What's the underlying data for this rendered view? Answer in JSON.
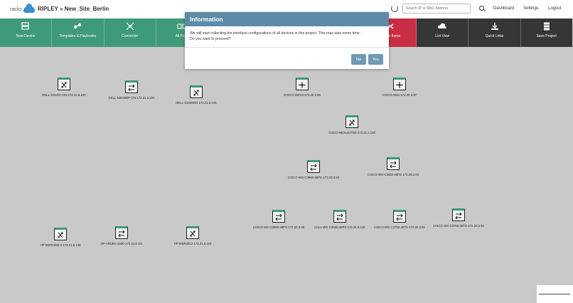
{
  "header": {
    "logo_text": "racks",
    "breadcrumb": "RIPLEY » New_Site_Berlin",
    "search_placeholder": "Search IP or MAC Address",
    "links": [
      "Dashboard",
      "Settings",
      "Logout"
    ]
  },
  "toolbar": [
    {
      "label": "New Device",
      "icon": "server-icon",
      "color": "#3f9a78"
    },
    {
      "label": "Templates & Playbooks",
      "icon": "ansible-icon",
      "color": "#3f9a78"
    },
    {
      "label": "Connector",
      "icon": "network-hub-icon",
      "color": "#3f9a78"
    },
    {
      "label": "All Ports",
      "icon": "ports-icon",
      "color": "#3f9a78"
    },
    {
      "label": "",
      "icon": "blank",
      "color": "#3f9a78"
    },
    {
      "label": "",
      "icon": "blank",
      "color": "#3f9a78"
    },
    {
      "label": "",
      "icon": "blank",
      "color": "#3f9a78"
    },
    {
      "label": "Delete Items",
      "icon": "delete-icon",
      "color": "#c92f44"
    },
    {
      "label": "List View",
      "icon": "cloud-icon",
      "color": "#363636"
    },
    {
      "label": "Quick Links",
      "icon": "download-icon",
      "color": "#363636"
    },
    {
      "label": "Save Project",
      "icon": "save-stack-icon",
      "color": "#363636"
    }
  ],
  "modal": {
    "title": "Information",
    "message_line1": "We will start collecting the interface configurations of all devices in this project. This may take some time.",
    "message_line2": "Do you want to proceed?",
    "no_label": "No",
    "yes_label": "Yes"
  },
  "devices": [
    {
      "label": "DELL-S4148T-ON-172.21.6.100",
      "type": "router"
    },
    {
      "label": "DELL-N3048EP-ON-172.21.6.102",
      "type": "switch"
    },
    {
      "label": "DELL-S4048ON-172.21.6.101",
      "type": "router"
    },
    {
      "label": "CISCO-1801N-172.20.3.98",
      "type": "hub"
    },
    {
      "label": "CISCO-2811-172.20.3.97",
      "type": "hub"
    },
    {
      "label": "CISCO-NEXUS7000-172.21.6.130",
      "type": "router"
    },
    {
      "label": "CISCO-WS-C3560-48PS-172.20.3.94",
      "type": "switch"
    },
    {
      "label": "CISCO-WS-C3560-48PS-172.20.3.93",
      "type": "switch"
    },
    {
      "label": "CISCO-WS-C3560-48PS-172.20.3.95",
      "type": "switch"
    },
    {
      "label": "Cisco-WS-C3650-48PS-172.21.6.120",
      "type": "switch"
    },
    {
      "label": "CISCO-WS-C3750-48TS-172.20.3.91",
      "type": "switch"
    },
    {
      "label": "CISCO-WS-C3750-48TS-172.20.3.92",
      "type": "switch"
    },
    {
      "label": "HP-MSR1002-4-172.21.6.132",
      "type": "router"
    },
    {
      "label": "HP-ARUBA-2920-172.21.6.111",
      "type": "switch"
    },
    {
      "label": "HP-MSR3012-172.21.6.110",
      "type": "router"
    }
  ]
}
